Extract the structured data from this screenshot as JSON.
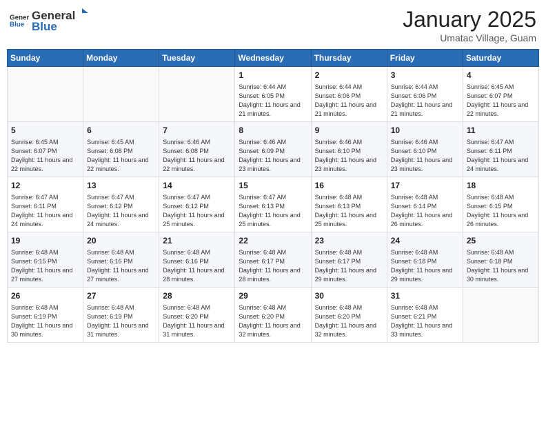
{
  "logo": {
    "general": "General",
    "blue": "Blue"
  },
  "header": {
    "month": "January 2025",
    "location": "Umatac Village, Guam"
  },
  "weekdays": [
    "Sunday",
    "Monday",
    "Tuesday",
    "Wednesday",
    "Thursday",
    "Friday",
    "Saturday"
  ],
  "weeks": [
    [
      {
        "day": "",
        "sunrise": "",
        "sunset": "",
        "daylight": ""
      },
      {
        "day": "",
        "sunrise": "",
        "sunset": "",
        "daylight": ""
      },
      {
        "day": "",
        "sunrise": "",
        "sunset": "",
        "daylight": ""
      },
      {
        "day": "1",
        "sunrise": "Sunrise: 6:44 AM",
        "sunset": "Sunset: 6:05 PM",
        "daylight": "Daylight: 11 hours and 21 minutes."
      },
      {
        "day": "2",
        "sunrise": "Sunrise: 6:44 AM",
        "sunset": "Sunset: 6:06 PM",
        "daylight": "Daylight: 11 hours and 21 minutes."
      },
      {
        "day": "3",
        "sunrise": "Sunrise: 6:44 AM",
        "sunset": "Sunset: 6:06 PM",
        "daylight": "Daylight: 11 hours and 21 minutes."
      },
      {
        "day": "4",
        "sunrise": "Sunrise: 6:45 AM",
        "sunset": "Sunset: 6:07 PM",
        "daylight": "Daylight: 11 hours and 22 minutes."
      }
    ],
    [
      {
        "day": "5",
        "sunrise": "Sunrise: 6:45 AM",
        "sunset": "Sunset: 6:07 PM",
        "daylight": "Daylight: 11 hours and 22 minutes."
      },
      {
        "day": "6",
        "sunrise": "Sunrise: 6:45 AM",
        "sunset": "Sunset: 6:08 PM",
        "daylight": "Daylight: 11 hours and 22 minutes."
      },
      {
        "day": "7",
        "sunrise": "Sunrise: 6:46 AM",
        "sunset": "Sunset: 6:08 PM",
        "daylight": "Daylight: 11 hours and 22 minutes."
      },
      {
        "day": "8",
        "sunrise": "Sunrise: 6:46 AM",
        "sunset": "Sunset: 6:09 PM",
        "daylight": "Daylight: 11 hours and 23 minutes."
      },
      {
        "day": "9",
        "sunrise": "Sunrise: 6:46 AM",
        "sunset": "Sunset: 6:10 PM",
        "daylight": "Daylight: 11 hours and 23 minutes."
      },
      {
        "day": "10",
        "sunrise": "Sunrise: 6:46 AM",
        "sunset": "Sunset: 6:10 PM",
        "daylight": "Daylight: 11 hours and 23 minutes."
      },
      {
        "day": "11",
        "sunrise": "Sunrise: 6:47 AM",
        "sunset": "Sunset: 6:11 PM",
        "daylight": "Daylight: 11 hours and 24 minutes."
      }
    ],
    [
      {
        "day": "12",
        "sunrise": "Sunrise: 6:47 AM",
        "sunset": "Sunset: 6:11 PM",
        "daylight": "Daylight: 11 hours and 24 minutes."
      },
      {
        "day": "13",
        "sunrise": "Sunrise: 6:47 AM",
        "sunset": "Sunset: 6:12 PM",
        "daylight": "Daylight: 11 hours and 24 minutes."
      },
      {
        "day": "14",
        "sunrise": "Sunrise: 6:47 AM",
        "sunset": "Sunset: 6:12 PM",
        "daylight": "Daylight: 11 hours and 25 minutes."
      },
      {
        "day": "15",
        "sunrise": "Sunrise: 6:47 AM",
        "sunset": "Sunset: 6:13 PM",
        "daylight": "Daylight: 11 hours and 25 minutes."
      },
      {
        "day": "16",
        "sunrise": "Sunrise: 6:48 AM",
        "sunset": "Sunset: 6:13 PM",
        "daylight": "Daylight: 11 hours and 25 minutes."
      },
      {
        "day": "17",
        "sunrise": "Sunrise: 6:48 AM",
        "sunset": "Sunset: 6:14 PM",
        "daylight": "Daylight: 11 hours and 26 minutes."
      },
      {
        "day": "18",
        "sunrise": "Sunrise: 6:48 AM",
        "sunset": "Sunset: 6:15 PM",
        "daylight": "Daylight: 11 hours and 26 minutes."
      }
    ],
    [
      {
        "day": "19",
        "sunrise": "Sunrise: 6:48 AM",
        "sunset": "Sunset: 6:15 PM",
        "daylight": "Daylight: 11 hours and 27 minutes."
      },
      {
        "day": "20",
        "sunrise": "Sunrise: 6:48 AM",
        "sunset": "Sunset: 6:16 PM",
        "daylight": "Daylight: 11 hours and 27 minutes."
      },
      {
        "day": "21",
        "sunrise": "Sunrise: 6:48 AM",
        "sunset": "Sunset: 6:16 PM",
        "daylight": "Daylight: 11 hours and 28 minutes."
      },
      {
        "day": "22",
        "sunrise": "Sunrise: 6:48 AM",
        "sunset": "Sunset: 6:17 PM",
        "daylight": "Daylight: 11 hours and 28 minutes."
      },
      {
        "day": "23",
        "sunrise": "Sunrise: 6:48 AM",
        "sunset": "Sunset: 6:17 PM",
        "daylight": "Daylight: 11 hours and 29 minutes."
      },
      {
        "day": "24",
        "sunrise": "Sunrise: 6:48 AM",
        "sunset": "Sunset: 6:18 PM",
        "daylight": "Daylight: 11 hours and 29 minutes."
      },
      {
        "day": "25",
        "sunrise": "Sunrise: 6:48 AM",
        "sunset": "Sunset: 6:18 PM",
        "daylight": "Daylight: 11 hours and 30 minutes."
      }
    ],
    [
      {
        "day": "26",
        "sunrise": "Sunrise: 6:48 AM",
        "sunset": "Sunset: 6:19 PM",
        "daylight": "Daylight: 11 hours and 30 minutes."
      },
      {
        "day": "27",
        "sunrise": "Sunrise: 6:48 AM",
        "sunset": "Sunset: 6:19 PM",
        "daylight": "Daylight: 11 hours and 31 minutes."
      },
      {
        "day": "28",
        "sunrise": "Sunrise: 6:48 AM",
        "sunset": "Sunset: 6:20 PM",
        "daylight": "Daylight: 11 hours and 31 minutes."
      },
      {
        "day": "29",
        "sunrise": "Sunrise: 6:48 AM",
        "sunset": "Sunset: 6:20 PM",
        "daylight": "Daylight: 11 hours and 32 minutes."
      },
      {
        "day": "30",
        "sunrise": "Sunrise: 6:48 AM",
        "sunset": "Sunset: 6:20 PM",
        "daylight": "Daylight: 11 hours and 32 minutes."
      },
      {
        "day": "31",
        "sunrise": "Sunrise: 6:48 AM",
        "sunset": "Sunset: 6:21 PM",
        "daylight": "Daylight: 11 hours and 33 minutes."
      },
      {
        "day": "",
        "sunrise": "",
        "sunset": "",
        "daylight": ""
      }
    ]
  ]
}
